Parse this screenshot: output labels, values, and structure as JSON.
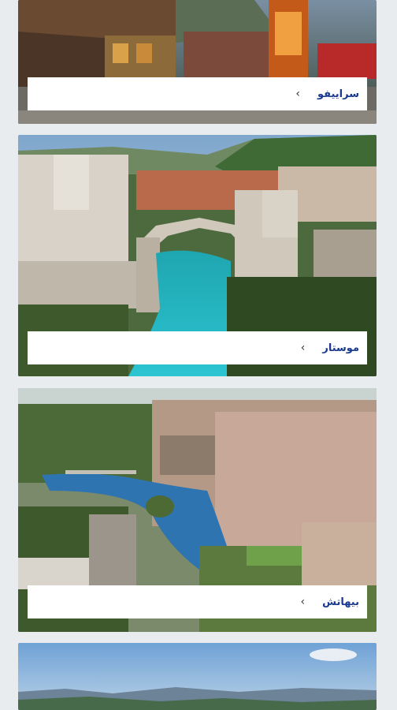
{
  "cities": [
    {
      "name": "سراييفو",
      "icon": "chevron-left-icon"
    },
    {
      "name": "موستار",
      "icon": "chevron-left-icon"
    },
    {
      "name": "بيهاتش",
      "icon": "chevron-left-icon"
    }
  ],
  "chevron_glyph": "‹",
  "colors": {
    "background": "#e9ecef",
    "label_text": "#1a3a8f",
    "label_bg": "#ffffff"
  }
}
